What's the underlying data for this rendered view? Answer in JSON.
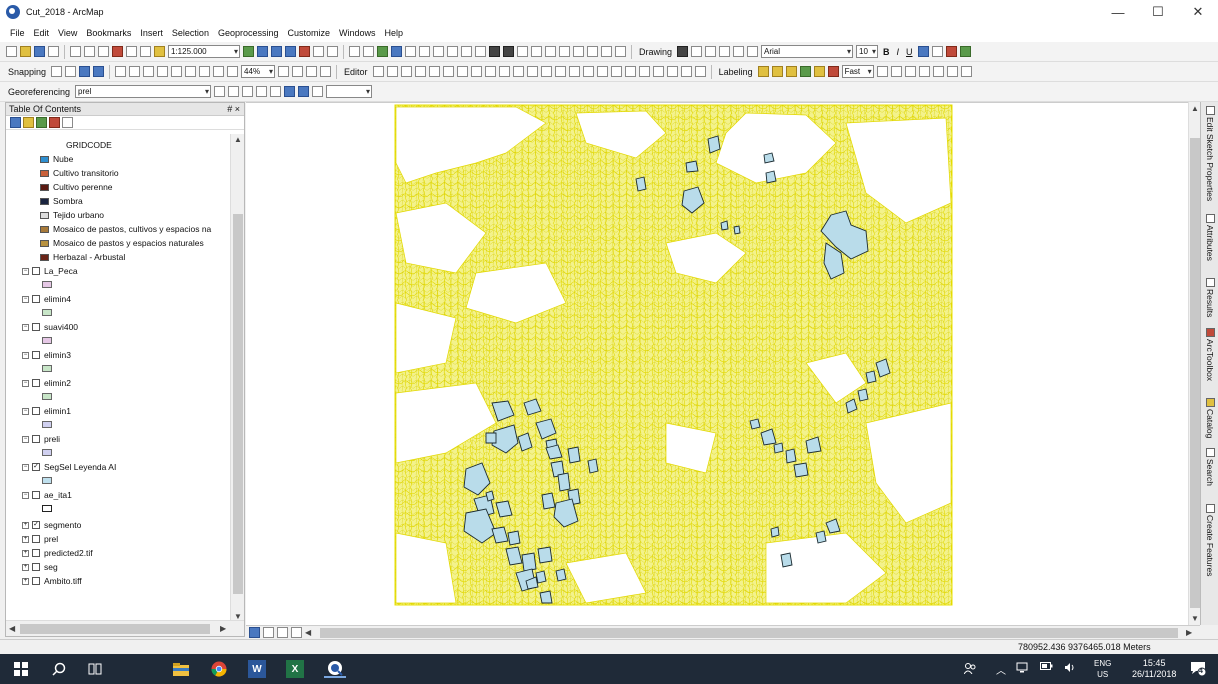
{
  "window": {
    "title": "Cut_2018 - ArcMap",
    "minimize": "—",
    "maximize": "☐",
    "close": "✕"
  },
  "menu": [
    "File",
    "Edit",
    "View",
    "Bookmarks",
    "Insert",
    "Selection",
    "Geoprocessing",
    "Customize",
    "Windows",
    "Help"
  ],
  "toolbar": {
    "scale": "1:125.000",
    "drawing_label": "Drawing",
    "font_name": "Arial",
    "font_size": "10",
    "bold": "B",
    "italic": "I",
    "underline": "U",
    "snapping_label": "Snapping",
    "zoom_percent": "44%",
    "editor_label": "Editor",
    "labeling_label": "Labeling",
    "label_quality": "Fast",
    "georef_label": "Georeferencing",
    "georef_layer": "prel"
  },
  "toc": {
    "title": "Table Of Contents",
    "pin": "# ×",
    "legend_heading": "GRIDCODE",
    "legend": [
      {
        "label": "Nube",
        "color": "#2f8fd0"
      },
      {
        "label": "Cultivo transitorio",
        "color": "#c8603a"
      },
      {
        "label": "Cultivo perenne",
        "color": "#5a1a12"
      },
      {
        "label": "Sombra",
        "color": "#1a2440"
      },
      {
        "label": "Tejido urbano",
        "color": "#dddddd"
      },
      {
        "label": "Mosaico de pastos, cultivos y espacios na",
        "color": "#a87a3a"
      },
      {
        "label": "Mosaico de pastos y espacios naturales",
        "color": "#b89240"
      },
      {
        "label": "Herbazal - Arbustal",
        "color": "#6a2418"
      }
    ],
    "layers": [
      {
        "name": "La_Peca",
        "checked": false,
        "swatch": "#e6c8e6"
      },
      {
        "name": "elimin4",
        "checked": false,
        "swatch": "#c8e6c8"
      },
      {
        "name": "suavi400",
        "checked": false,
        "swatch": "#e6c8e6"
      },
      {
        "name": "elimin3",
        "checked": false,
        "swatch": "#c8e6c8"
      },
      {
        "name": "elimin2",
        "checked": false,
        "swatch": "#c8e6c8"
      },
      {
        "name": "elimin1",
        "checked": false,
        "swatch": "#d0d0f0"
      },
      {
        "name": "preli",
        "checked": false,
        "swatch": "#d0d0f0"
      },
      {
        "name": "SegSel Leyenda AI",
        "checked": true,
        "swatch": "#bfe0ee"
      },
      {
        "name": "ae_ita1",
        "checked": false,
        "swatch": "#ffffff"
      }
    ],
    "collapsed_layers": [
      {
        "name": "segmento",
        "checked": true
      },
      {
        "name": "prel",
        "checked": false
      },
      {
        "name": "predicted2.tif",
        "checked": false
      },
      {
        "name": "seg",
        "checked": false
      },
      {
        "name": "Ambito.tiff",
        "checked": false
      }
    ]
  },
  "dock_tabs": [
    "Edit Sketch Properties",
    "Attributes",
    "Results",
    "ArcToolbox",
    "Catalog",
    "Search",
    "Create Features"
  ],
  "status": {
    "coordinates": "780952.436  9376465.018 Meters"
  },
  "taskbar": {
    "lang_top": "ENG",
    "lang_bottom": "US",
    "time": "15:45",
    "date": "26/11/2018",
    "notifications": "4"
  },
  "colors": {
    "map_fill": "#f0f07a",
    "map_stroke": "#e8e000",
    "polygon_fill": "#b9dcea",
    "polygon_stroke": "#1a2a30"
  }
}
